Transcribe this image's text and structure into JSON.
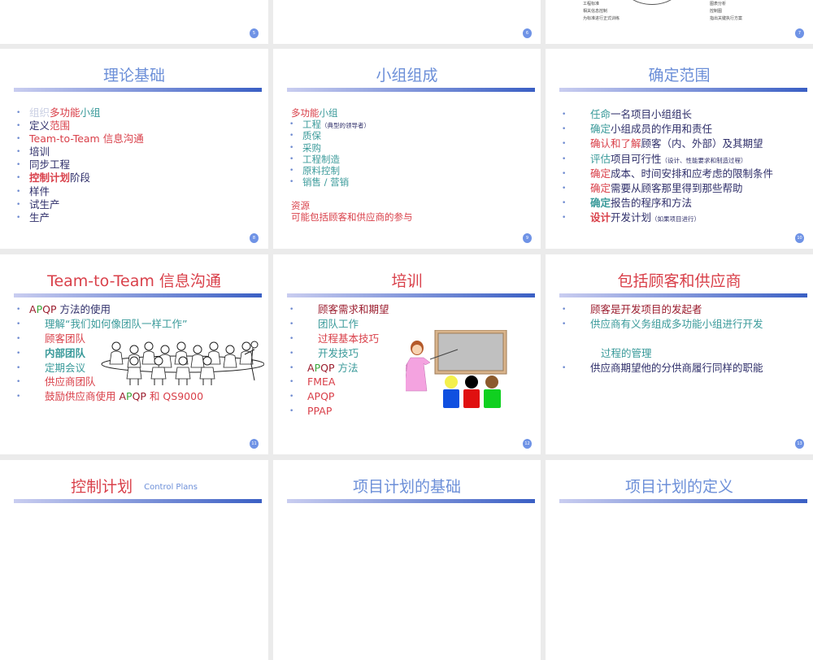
{
  "palette": {
    "blue": "#6c8fd8",
    "red": "#d9404a",
    "darkred": "#9b1d2e",
    "teal": "#3a9a9a",
    "navy": "#2f2f6a",
    "light": "#c9cfe3",
    "green": "#3aa53a",
    "badge": "#6f93e6"
  },
  "slides": [
    {
      "num": "5",
      "pos": "c0 r0",
      "cls": "s5"
    },
    {
      "num": "6",
      "pos": "c1 r0",
      "cls": "s6"
    },
    {
      "num": "7",
      "pos": "c2 r0",
      "cls": "s7",
      "partial_left": [
        "工程标准",
        "相关信息控制",
        "为标准进行正式训练"
      ],
      "partial_right": [
        "图表分析",
        "控制图",
        "指出关键执行方案"
      ]
    },
    {
      "num": "8",
      "pos": "c0 r1",
      "cls": "s8",
      "title": "理论基础",
      "title_color": "blue",
      "lines": [
        {
          "segs": [
            [
              "组织",
              "light"
            ],
            [
              "多功能",
              "red"
            ],
            [
              "小组",
              "teal"
            ]
          ]
        },
        {
          "segs": [
            [
              "定义",
              "navy"
            ],
            [
              "范围",
              "red"
            ]
          ]
        },
        {
          "segs": [
            [
              "Team-to-Team  信息沟通",
              "red"
            ]
          ]
        },
        {
          "segs": [
            [
              "培训",
              "navy"
            ]
          ]
        },
        {
          "segs": [
            [
              "同步工程",
              "navy"
            ]
          ]
        },
        {
          "segs": [
            [
              "控制计划",
              "red",
              "bold"
            ],
            [
              "阶段",
              "navy"
            ]
          ]
        },
        {
          "segs": [
            [
              "样件",
              "navy"
            ]
          ]
        },
        {
          "segs": [
            [
              "试生产",
              "navy"
            ]
          ]
        },
        {
          "segs": [
            [
              "生产",
              "navy"
            ]
          ]
        }
      ]
    },
    {
      "num": "9",
      "pos": "c1 r1",
      "cls": "s9",
      "title": "小组组成",
      "title_color": "blue",
      "lines": [
        {
          "nb": true,
          "segs": [
            [
              "多功能",
              "red"
            ],
            [
              "小组",
              "teal"
            ]
          ]
        },
        {
          "segs": [
            [
              "工程",
              "teal"
            ],
            [
              "（典型的领导者）",
              "navy",
              "small"
            ]
          ]
        },
        {
          "segs": [
            [
              "质保",
              "teal"
            ]
          ]
        },
        {
          "segs": [
            [
              "采购",
              "teal"
            ]
          ]
        },
        {
          "segs": [
            [
              "工程制造",
              "teal"
            ]
          ]
        },
        {
          "segs": [
            [
              "原料控制",
              "teal"
            ]
          ]
        },
        {
          "segs": [
            [
              "销售 / 营销",
              "teal"
            ]
          ]
        },
        {
          "spacer": true
        },
        {
          "nb": true,
          "segs": [
            [
              "资源",
              "red"
            ]
          ]
        },
        {
          "nb": true,
          "segs": [
            [
              "可能包括顾客和供应商的参与",
              "red"
            ]
          ]
        }
      ]
    },
    {
      "num": "10",
      "pos": "c2 r1",
      "cls": "s10",
      "title": "确定范围",
      "title_color": "blue",
      "lines": [
        {
          "segs": [
            [
              "任命",
              "teal"
            ],
            [
              "一名项目小组组长",
              "navy"
            ]
          ]
        },
        {
          "segs": [
            [
              "确定",
              "teal"
            ],
            [
              "小组成员的作用和责任",
              "navy"
            ]
          ]
        },
        {
          "segs": [
            [
              "确认和了解",
              "red"
            ],
            [
              "顾客（内、外部）及其期望",
              "navy"
            ]
          ]
        },
        {
          "segs": [
            [
              "评估",
              "teal"
            ],
            [
              "项目可行性",
              "navy"
            ],
            [
              "（设计、性能要求和制造过程）",
              "navy",
              "small"
            ]
          ]
        },
        {
          "segs": [
            [
              "确定",
              "red"
            ],
            [
              "成本、时间安排和应考虑的限制条件",
              "navy"
            ]
          ]
        },
        {
          "segs": [
            [
              "确定",
              "red"
            ],
            [
              "需要从顾客那里得到那些帮助",
              "navy"
            ]
          ]
        },
        {
          "segs": [
            [
              "确定",
              "teal",
              "bold"
            ],
            [
              "报告的程序和方法",
              "navy"
            ]
          ]
        },
        {
          "segs": [
            [
              "设计",
              "red",
              "bold"
            ],
            [
              "开发计划",
              "navy"
            ],
            [
              "（如果项目进行）",
              "navy",
              "small"
            ]
          ]
        }
      ]
    },
    {
      "num": "11",
      "pos": "c0 r2",
      "cls": "s11",
      "title": "Team-to-Team  信息沟通",
      "title_color": "red",
      "pic": "meeting",
      "lines": [
        {
          "segs": [
            [
              "A",
              "darkred"
            ],
            [
              "P",
              "green"
            ],
            [
              "QP",
              "darkred"
            ],
            [
              " 方法的使用",
              "navy"
            ]
          ]
        },
        {
          "ind": true,
          "segs": [
            [
              "理解“我们如何像团队一样工作”",
              "teal"
            ]
          ]
        },
        {
          "ind": true,
          "segs": [
            [
              "顾客团队",
              "red"
            ]
          ]
        },
        {
          "ind": true,
          "segs": [
            [
              "内部团队",
              "teal",
              "bold"
            ]
          ]
        },
        {
          "ind": true,
          "segs": [
            [
              "定期会议",
              "teal"
            ]
          ]
        },
        {
          "ind": true,
          "segs": [
            [
              "供应商团队",
              "red"
            ]
          ]
        },
        {
          "ind": true,
          "segs": [
            [
              "鼓励供应商使用 ",
              "red"
            ],
            [
              "A",
              "darkred"
            ],
            [
              "P",
              "green"
            ],
            [
              "QP",
              "darkred"
            ],
            [
              " 和 QS9000",
              "red"
            ]
          ]
        }
      ]
    },
    {
      "num": "12",
      "pos": "c1 r2",
      "cls": "s12",
      "title": "培训",
      "title_color": "red",
      "pic": "classroom",
      "lines": [
        {
          "ind": true,
          "segs": [
            [
              "顾客需求和期望",
              "darkred"
            ]
          ]
        },
        {
          "ind": true,
          "segs": [
            [
              "团队工作",
              "teal"
            ]
          ]
        },
        {
          "ind": true,
          "segs": [
            [
              "过程基本技巧",
              "red"
            ]
          ]
        },
        {
          "ind": true,
          "segs": [
            [
              "开发技巧",
              "teal"
            ]
          ]
        },
        {
          "segs": [
            [
              "A",
              "darkred"
            ],
            [
              "P",
              "green"
            ],
            [
              "QP",
              "darkred"
            ],
            [
              " 方法",
              "teal"
            ]
          ]
        },
        {
          "segs": [
            [
              "FMEA",
              "red"
            ]
          ]
        },
        {
          "segs": [
            [
              "APQP",
              "red"
            ]
          ]
        },
        {
          "segs": [
            [
              "PPAP",
              "red"
            ]
          ]
        }
      ]
    },
    {
      "num": "13",
      "pos": "c2 r2",
      "cls": "s13",
      "title": "包括顾客和供应商",
      "title_color": "red",
      "lines": [
        {
          "segs": [
            [
              "顾客是开发项目的发起者",
              "darkred"
            ]
          ]
        },
        {
          "segs": [
            [
              "供应商有义务组成多功能小组进行开发",
              "teal"
            ]
          ]
        },
        {
          "spacer": true
        },
        {
          "nb": true,
          "ind2": true,
          "segs": [
            [
              "过程的管理",
              "teal"
            ]
          ]
        },
        {
          "segs": [
            [
              "供应商期望他的分供商履行同样的职能",
              "navy"
            ]
          ]
        }
      ]
    },
    {
      "pos": "c0 r3",
      "cls": "s14",
      "title": "控制计划",
      "title_color": "red",
      "subtitle": "Control Plans",
      "subtitle_color": "blue"
    },
    {
      "pos": "c1 r3",
      "cls": "s15",
      "title": "项目计划的基础",
      "title_color": "blue"
    },
    {
      "pos": "c2 r3",
      "cls": "s16",
      "title": "项目计划的定义",
      "title_color": "blue"
    }
  ]
}
